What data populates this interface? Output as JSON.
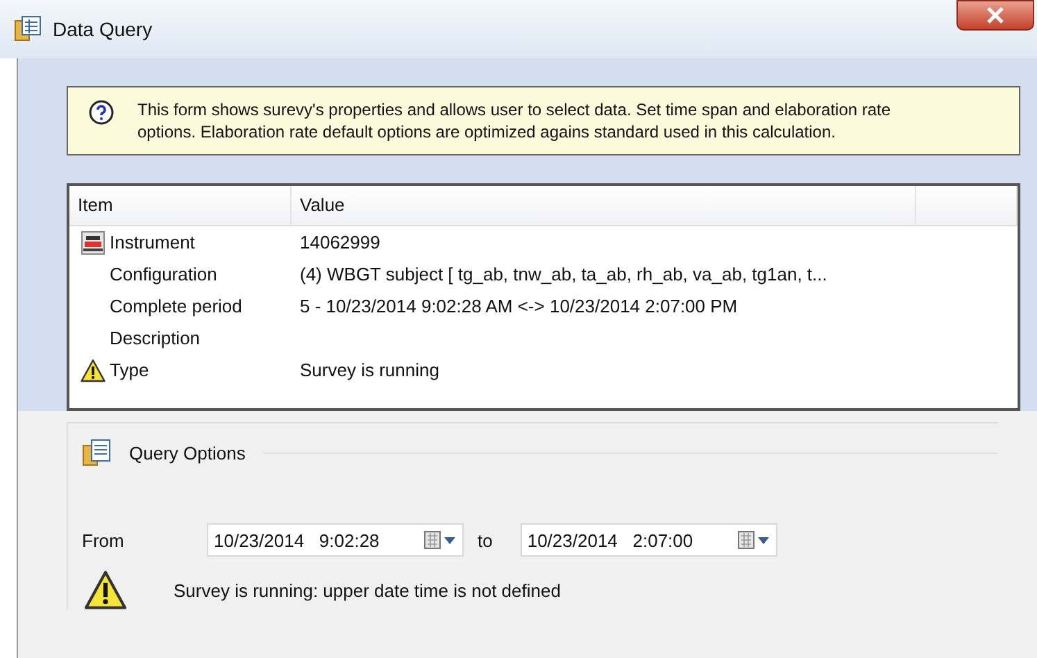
{
  "window": {
    "title": "Data Query"
  },
  "info": {
    "text": "This form shows surevy's properties and allows user to select data. Set time span and elaboration rate options. Elaboration rate default options are optimized agains standard used in this calculation."
  },
  "table": {
    "columns": [
      "Item",
      "Value"
    ],
    "rows": [
      {
        "kind": "instrument",
        "item": "Instrument",
        "value": "14062999"
      },
      {
        "kind": "plain",
        "item": "Configuration",
        "value": "(4) WBGT subject [ tg_ab, tnw_ab, ta_ab, rh_ab, va_ab, tg1an, t..."
      },
      {
        "kind": "plain",
        "item": "Complete period",
        "value": "5 - 10/23/2014 9:02:28 AM <-> 10/23/2014 2:07:00 PM"
      },
      {
        "kind": "plain",
        "item": "Description"
      },
      {
        "kind": "warning",
        "item": "Type",
        "value": "Survey is running"
      }
    ]
  },
  "query_options": {
    "title": "Query Options",
    "from_label": "From",
    "from_value": "10/23/2014   9:02:28",
    "to_label": "to",
    "to_value": "10/23/2014   2:07:00",
    "warning": "Survey is running: upper date time is not defined"
  }
}
